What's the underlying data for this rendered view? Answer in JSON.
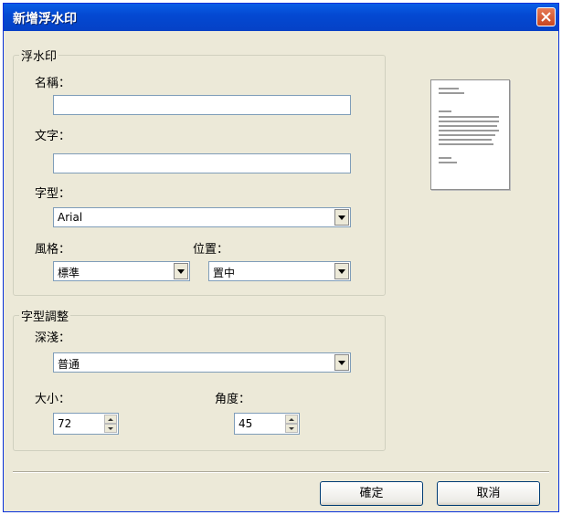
{
  "window": {
    "title": "新增浮水印"
  },
  "watermark_group": {
    "legend": "浮水印",
    "name_label": "名稱：",
    "name_value": "",
    "text_label": "文字：",
    "text_value": "",
    "font_label": "字型：",
    "font_value": "Arial",
    "style_label": "風格：",
    "style_value": "標準",
    "position_label": "位置：",
    "position_value": "置中"
  },
  "adjust_group": {
    "legend": "字型調整",
    "shade_label": "深淺：",
    "shade_value": "普通",
    "size_label": "大小：",
    "size_value": "72",
    "angle_label": "角度：",
    "angle_value": "45"
  },
  "buttons": {
    "ok": "確定",
    "cancel": "取消"
  },
  "icons": {
    "close": "close-icon",
    "dropdown": "chevron-down-icon",
    "spinner": "spin-arrows-icon"
  },
  "colors": {
    "titlebar": "#0449d2",
    "dialog_bg": "#ece9d8",
    "close_button": "#c84621"
  }
}
